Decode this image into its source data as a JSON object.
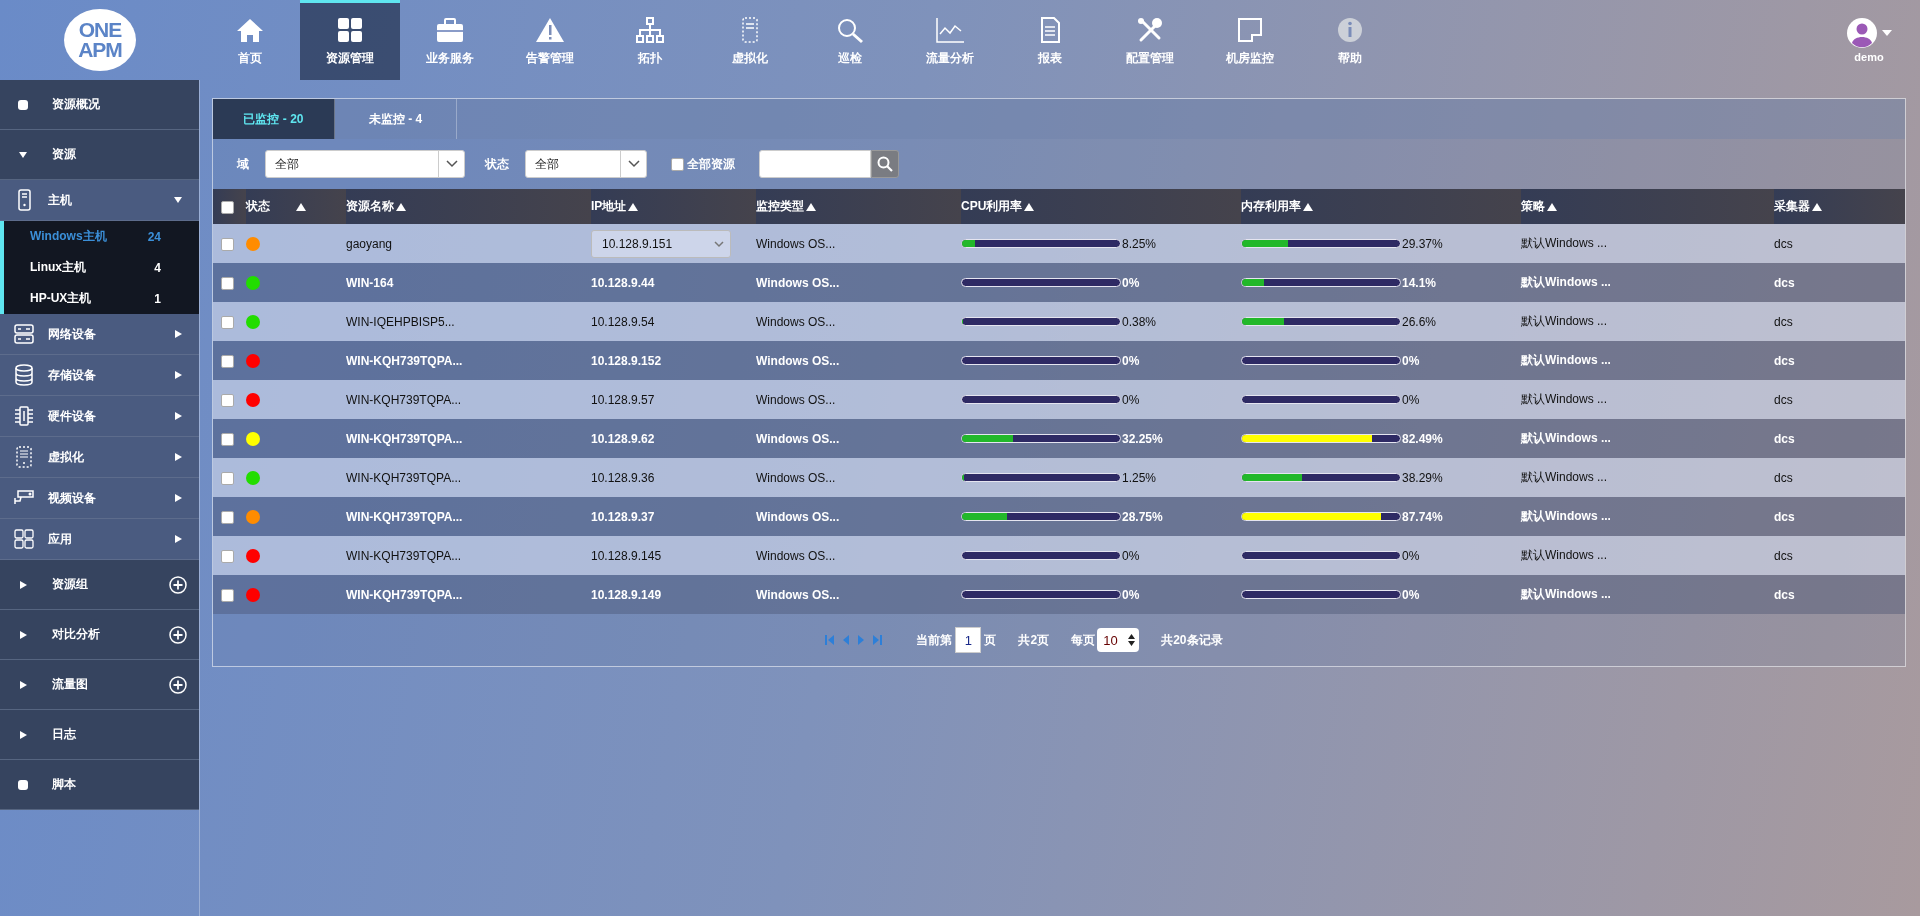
{
  "logo": {
    "line_1": "ONE",
    "line_2": "APM"
  },
  "nav": [
    {
      "label": "首页",
      "selected": false
    },
    {
      "label": "资源管理",
      "selected": true
    },
    {
      "label": "业务服务",
      "selected": false
    },
    {
      "label": "告警管理",
      "selected": false
    },
    {
      "label": "拓扑",
      "selected": false
    },
    {
      "label": "虚拟化",
      "selected": false
    },
    {
      "label": "巡检",
      "selected": false
    },
    {
      "label": "流量分析",
      "selected": false
    },
    {
      "label": "报表",
      "selected": false
    },
    {
      "label": "配置管理",
      "selected": false
    },
    {
      "label": "机房监控",
      "selected": false
    },
    {
      "label": "帮助",
      "selected": false
    }
  ],
  "user": {
    "name": "demo"
  },
  "sidebar": {
    "items": [
      {
        "kind": "dot",
        "label": "资源概况"
      },
      {
        "kind": "toggle",
        "label": "资源",
        "expanded": true,
        "addable": false,
        "children": [
          {
            "label": "主机",
            "expanded": true,
            "children": [
              {
                "label": "Windows主机",
                "count": "24",
                "selected": true
              },
              {
                "label": "Linux主机",
                "count": "4",
                "selected": false
              },
              {
                "label": "HP-UX主机",
                "count": "1",
                "selected": false
              }
            ]
          },
          {
            "label": "网络设备",
            "expanded": false
          },
          {
            "label": "存储设备",
            "expanded": false
          },
          {
            "label": "硬件设备",
            "expanded": false
          },
          {
            "label": "虚拟化",
            "expanded": false
          },
          {
            "label": "视频设备",
            "expanded": false
          },
          {
            "label": "应用",
            "expanded": false
          }
        ]
      },
      {
        "kind": "toggle",
        "label": "资源组",
        "expanded": false,
        "addable": true
      },
      {
        "kind": "toggle",
        "label": "对比分析",
        "expanded": false,
        "addable": true
      },
      {
        "kind": "toggle",
        "label": "流量图",
        "expanded": false,
        "addable": true
      },
      {
        "kind": "toggle",
        "label": "日志",
        "expanded": false,
        "addable": false
      },
      {
        "kind": "dot",
        "label": "脚本"
      }
    ]
  },
  "tabs": [
    {
      "label": "已监控 - 20",
      "selected": true
    },
    {
      "label": "未监控 - 4",
      "selected": false
    }
  ],
  "filters": {
    "domain_label": "域",
    "domain_value": "全部",
    "status_label": "状态",
    "status_value": "全部",
    "all_resources_label": "全部资源",
    "all_resources_checked": false
  },
  "table": {
    "select_all_checked": false,
    "columns": [
      "状态",
      "资源名称",
      "IP地址",
      "监控类型",
      "CPU利用率",
      "内存利用率",
      "策略",
      "采集器"
    ],
    "rows": [
      {
        "checked": false,
        "color": "#ff8c00",
        "name": "gaoyang",
        "ip": "10.128.9.151",
        "ip_dropdown": true,
        "type": "Windows OS...",
        "cpu": {
          "level": 0.0825,
          "reading": "8.25%"
        },
        "mem": {
          "level": 0.2937,
          "reading": "29.37%"
        },
        "policy": "默认Windows ...",
        "collector": "dcs"
      },
      {
        "checked": false,
        "color": "#22dd00",
        "name": "WIN-164",
        "ip": "10.128.9.44",
        "ip_dropdown": false,
        "type": "Windows OS...",
        "cpu": {
          "level": 0,
          "reading": "0%"
        },
        "mem": {
          "level": 0.141,
          "reading": "14.1%"
        },
        "policy": "默认Windows ...",
        "collector": "dcs"
      },
      {
        "checked": false,
        "color": "#22dd00",
        "name": "WIN-IQEHPBISP5...",
        "ip": "10.128.9.54",
        "ip_dropdown": false,
        "type": "Windows OS...",
        "cpu": {
          "level": 0.0038,
          "reading": "0.38%"
        },
        "mem": {
          "level": 0.266,
          "reading": "26.6%"
        },
        "policy": "默认Windows ...",
        "collector": "dcs"
      },
      {
        "checked": false,
        "color": "#ff0000",
        "name": "WIN-KQH739TQPA...",
        "ip": "10.128.9.152",
        "ip_dropdown": false,
        "type": "Windows OS...",
        "cpu": {
          "level": 0,
          "reading": "0%"
        },
        "mem": {
          "level": 0,
          "reading": "0%"
        },
        "policy": "默认Windows ...",
        "collector": "dcs"
      },
      {
        "checked": false,
        "color": "#ff0000",
        "name": "WIN-KQH739TQPA...",
        "ip": "10.128.9.57",
        "ip_dropdown": false,
        "type": "Windows OS...",
        "cpu": {
          "level": 0,
          "reading": "0%"
        },
        "mem": {
          "level": 0,
          "reading": "0%"
        },
        "policy": "默认Windows ...",
        "collector": "dcs"
      },
      {
        "checked": false,
        "color": "#ffff00",
        "name": "WIN-KQH739TQPA...",
        "ip": "10.128.9.62",
        "ip_dropdown": false,
        "type": "Windows OS...",
        "cpu": {
          "level": 0.3225,
          "reading": "32.25%"
        },
        "mem": {
          "level": 0.8249,
          "reading": "82.49%"
        },
        "policy": "默认Windows ...",
        "collector": "dcs"
      },
      {
        "checked": false,
        "color": "#22dd00",
        "name": "WIN-KQH739TQPA...",
        "ip": "10.128.9.36",
        "ip_dropdown": false,
        "type": "Windows OS...",
        "cpu": {
          "level": 0.0125,
          "reading": "1.25%"
        },
        "mem": {
          "level": 0.3829,
          "reading": "38.29%"
        },
        "policy": "默认Windows ...",
        "collector": "dcs"
      },
      {
        "checked": false,
        "color": "#ff8c00",
        "name": "WIN-KQH739TQPA...",
        "ip": "10.128.9.37",
        "ip_dropdown": false,
        "type": "Windows OS...",
        "cpu": {
          "level": 0.2875,
          "reading": "28.75%"
        },
        "mem": {
          "level": 0.8774,
          "reading": "87.74%"
        },
        "policy": "默认Windows ...",
        "collector": "dcs"
      },
      {
        "checked": false,
        "color": "#ff0000",
        "name": "WIN-KQH739TQPA...",
        "ip": "10.128.9.145",
        "ip_dropdown": false,
        "type": "Windows OS...",
        "cpu": {
          "level": 0,
          "reading": "0%"
        },
        "mem": {
          "level": 0,
          "reading": "0%"
        },
        "policy": "默认Windows ...",
        "collector": "dcs"
      },
      {
        "checked": false,
        "color": "#ff0000",
        "name": "WIN-KQH739TQPA...",
        "ip": "10.128.9.149",
        "ip_dropdown": false,
        "type": "Windows OS...",
        "cpu": {
          "level": 0,
          "reading": "0%"
        },
        "mem": {
          "level": 0,
          "reading": "0%"
        },
        "policy": "默认Windows ...",
        "collector": "dcs"
      }
    ]
  },
  "pagination": {
    "current_prefix": "当前第",
    "current_page": "1",
    "current_suffix": "页",
    "total_pages": "共2页",
    "per_page_label": "每页",
    "per_page": "10",
    "total_records": "共20条记录"
  }
}
